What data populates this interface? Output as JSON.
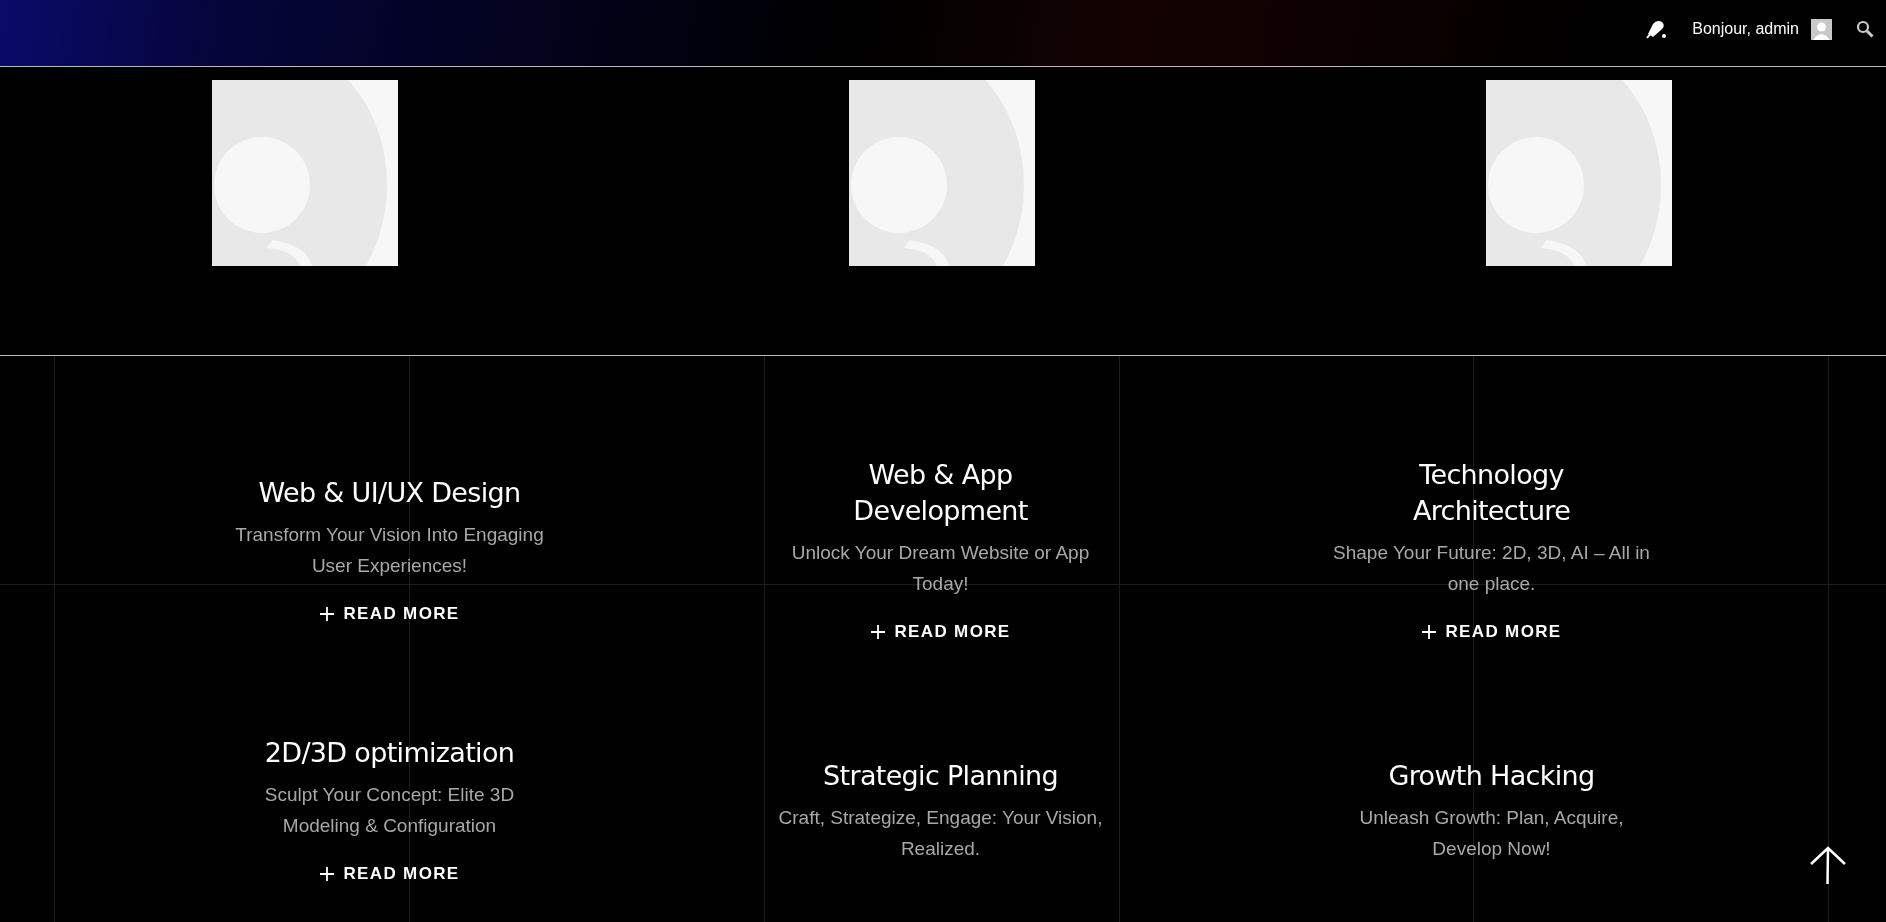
{
  "top_bar": {
    "greeting": "Bonjour, admin"
  },
  "services": [
    {
      "title": "Web & UI/UX Design",
      "description": "Transform Your Vision Into Engaging User Experiences!",
      "link": "READ MORE"
    },
    {
      "title": "Web & App Development",
      "description": "Unlock Your Dream Website or App Today!",
      "link": "READ MORE"
    },
    {
      "title": "Technology Architecture",
      "description": "Shape Your Future: 2D, 3D, AI – All in one place.",
      "link": "READ MORE"
    },
    {
      "title": "2D/3D optimization",
      "description": "Sculpt Your Concept: Elite 3D Modeling & Configuration",
      "link": "READ MORE"
    },
    {
      "title": "Strategic Planning",
      "description": "Craft, Strategize, Engage: Your Vision, Realized."
    },
    {
      "title": "Growth Hacking",
      "description": "Unleash Growth: Plan, Acquire, Develop Now!"
    }
  ]
}
